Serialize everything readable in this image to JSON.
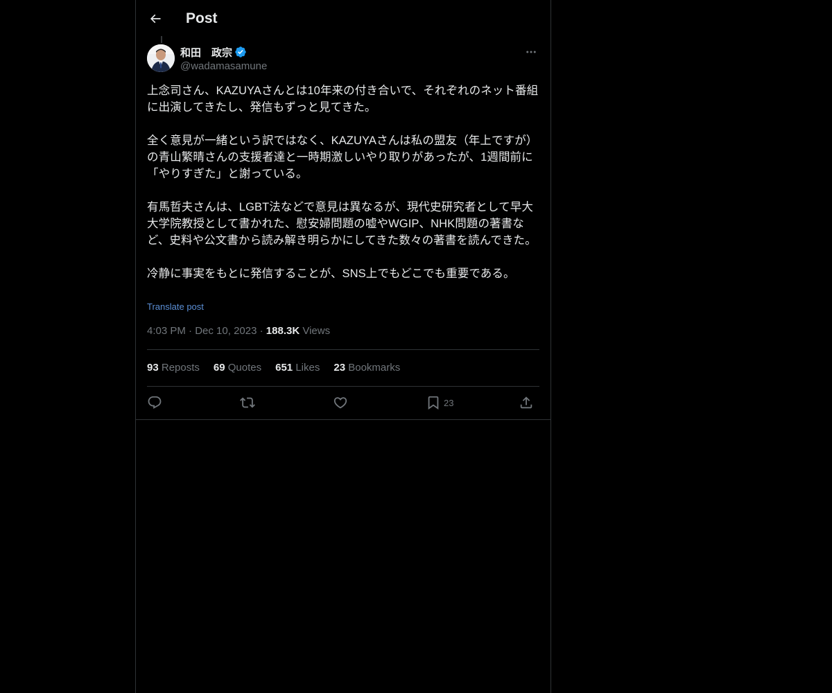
{
  "header": {
    "title": "Post"
  },
  "author": {
    "name": "和田　政宗",
    "handle": "@wadamasamune"
  },
  "tweet": {
    "paragraphs": [
      "上念司さん、KAZUYAさんとは10年来の付き合いで、それぞれのネット番組に出演してきたし、発信もずっと見てきた。",
      "全く意見が一緒という訳ではなく、KAZUYAさんは私の盟友（年上ですが）の青山繁晴さんの支援者達と一時期激しいやり取りがあったが、1週間前に「やりすぎた」と謝っている。",
      "有馬哲夫さんは、LGBT法などで意見は異なるが、現代史研究者として早大大学院教授として書かれた、慰安婦問題の嘘やWGIP、NHK問題の著書など、史料や公文書から読み解き明らかにしてきた数々の著書を読んできた。",
      "冷静に事実をもとに発信することが、SNS上でもどこでも重要である。"
    ],
    "translate_label": "Translate post",
    "time": "4:03 PM",
    "separator": "·",
    "date": "Dec 10, 2023",
    "views_count": "188.3K",
    "views_label": "Views"
  },
  "stats": {
    "reposts": {
      "count": "93",
      "label": "Reposts"
    },
    "quotes": {
      "count": "69",
      "label": "Quotes"
    },
    "likes": {
      "count": "651",
      "label": "Likes"
    },
    "bookmarks": {
      "count": "23",
      "label": "Bookmarks"
    }
  },
  "actions": {
    "bookmark_count": "23"
  },
  "colors": {
    "background": "#000000",
    "text": "#e7e9ea",
    "muted": "#71767b",
    "border": "#2f3336",
    "link": "#5b8fd6",
    "verified": "#1d9bf0"
  },
  "icons": {
    "back": "arrow-left-icon",
    "verified": "verified-badge-icon",
    "more": "more-horizontal-icon",
    "reply": "reply-icon",
    "repost": "repost-icon",
    "like": "heart-icon",
    "bookmark": "bookmark-icon",
    "share": "share-icon"
  }
}
